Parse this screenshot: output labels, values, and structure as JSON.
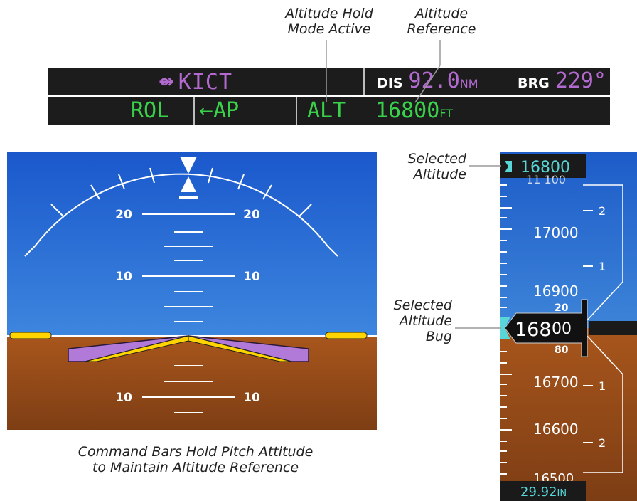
{
  "annotations": {
    "alt_hold_mode": [
      "Altitude Hold",
      "Mode Active"
    ],
    "alt_reference": [
      "Altitude",
      "Reference"
    ],
    "selected_altitude": [
      "Selected",
      "Altitude"
    ],
    "selected_altitude_bug": [
      "Selected",
      "Altitude",
      "Bug"
    ],
    "caption": [
      "Command Bars Hold Pitch Attitude",
      "to Maintain Altitude Reference"
    ]
  },
  "nav_status": {
    "leg_symbol": "⇴",
    "waypoint": "KICT",
    "dis_label": "DIS",
    "dis_value": "92.0",
    "dis_unit": "NM",
    "brg_label": "BRG",
    "brg_value": "229°"
  },
  "afcs_status": {
    "lateral_mode": "ROL",
    "ap_label": "AP",
    "vertical_mode": "ALT",
    "alt_reference_value": "16800",
    "alt_reference_unit": "FT"
  },
  "attitude": {
    "pitch_labels": {
      "up20": "20",
      "up10": "10",
      "down10": "10"
    }
  },
  "altimeter": {
    "selected_altitude": "16800",
    "tape_labels": [
      "17000",
      "16900",
      "16700",
      "16600",
      "16500"
    ],
    "current_hundreds": "168",
    "current_tens": "00",
    "roller_above": "20",
    "roller_below": "80",
    "vsi_labels": [
      "2",
      "1",
      "1",
      "2"
    ],
    "baro_value": "29.92",
    "baro_unit": "IN"
  },
  "colors": {
    "green": "#39d14a",
    "magenta": "#b36ad0",
    "cyan": "#58d6d8",
    "sky": "#1f5fcf",
    "ground": "#a4531c",
    "command_bars": "#b27ad8",
    "aircraft_symbol": "#ffd400"
  }
}
